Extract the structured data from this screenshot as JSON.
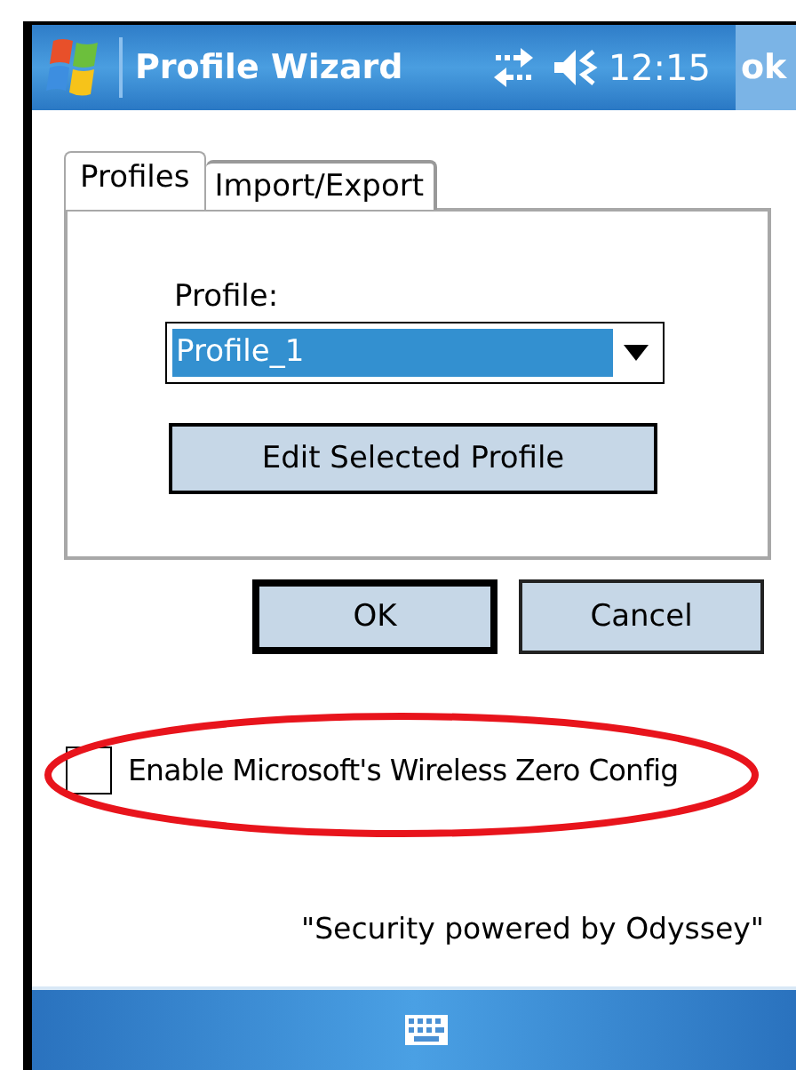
{
  "title_bar": {
    "title": "Profile Wizard",
    "time": "12:15",
    "ok_button": "ok"
  },
  "tabs": [
    {
      "label": "Profiles",
      "selected": true
    },
    {
      "label": "Import/Export",
      "selected": false
    }
  ],
  "profile_field": {
    "label": "Profile:",
    "value": "Profile_1"
  },
  "edit_button": "Edit Selected Profile",
  "buttons": [
    {
      "label": "OK",
      "default": true
    },
    {
      "label": "Cancel",
      "default": false
    }
  ],
  "wzc_checkbox": {
    "label": "Enable Microsoft's Wireless Zero Config",
    "checked": false,
    "highlighted": true
  },
  "footer": "\"Security powered by Odyssey\""
}
